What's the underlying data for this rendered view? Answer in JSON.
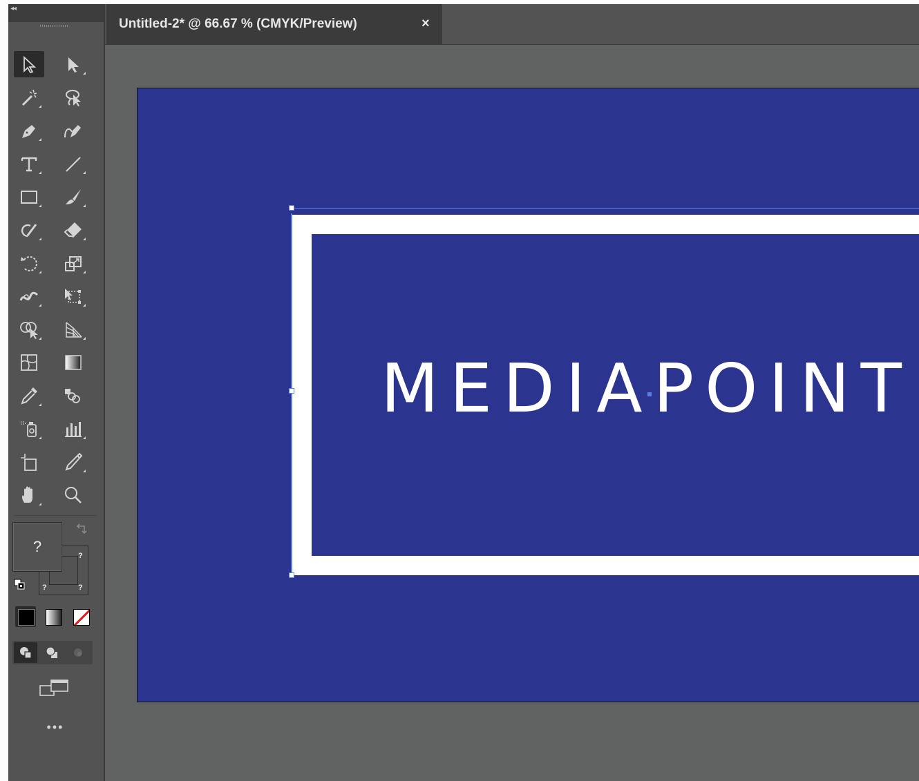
{
  "toolbar": {
    "collapse_label": "◂◂",
    "tools": [
      {
        "id": "selection-tool",
        "icon": "selection-arrow"
      },
      {
        "id": "direct-selection-tool",
        "icon": "direct-selection-arrow"
      },
      {
        "id": "magic-wand-tool",
        "icon": "magic-wand"
      },
      {
        "id": "lasso-tool",
        "icon": "lasso"
      },
      {
        "id": "pen-tool",
        "icon": "pen"
      },
      {
        "id": "curvature-tool",
        "icon": "curvature-pen"
      },
      {
        "id": "type-tool",
        "icon": "type-t"
      },
      {
        "id": "line-segment-tool",
        "icon": "line"
      },
      {
        "id": "rectangle-tool",
        "icon": "rectangle"
      },
      {
        "id": "paintbrush-tool",
        "icon": "brush"
      },
      {
        "id": "shaper-tool",
        "icon": "shaper"
      },
      {
        "id": "eraser-tool",
        "icon": "eraser"
      },
      {
        "id": "rotate-tool",
        "icon": "rotate"
      },
      {
        "id": "scale-tool",
        "icon": "scale"
      },
      {
        "id": "width-tool",
        "icon": "width"
      },
      {
        "id": "free-transform-tool",
        "icon": "free-transform"
      },
      {
        "id": "shape-builder-tool",
        "icon": "shape-builder"
      },
      {
        "id": "perspective-grid-tool",
        "icon": "perspective-grid"
      },
      {
        "id": "mesh-tool",
        "icon": "mesh"
      },
      {
        "id": "gradient-tool",
        "icon": "gradient"
      },
      {
        "id": "eyedropper-tool",
        "icon": "eyedropper"
      },
      {
        "id": "blend-tool",
        "icon": "blend"
      },
      {
        "id": "symbol-sprayer-tool",
        "icon": "symbol-sprayer"
      },
      {
        "id": "column-graph-tool",
        "icon": "column-graph"
      },
      {
        "id": "artboard-tool",
        "icon": "artboard"
      },
      {
        "id": "slice-tool",
        "icon": "slice-knife"
      },
      {
        "id": "hand-tool",
        "icon": "hand"
      },
      {
        "id": "zoom-tool",
        "icon": "magnifier"
      }
    ],
    "fill_value": "?",
    "stroke_values": [
      "?",
      "?",
      "?"
    ],
    "more_label": "•••"
  },
  "document": {
    "tab_title": "Untitled-2* @ 66.67 % (CMYK/Preview)",
    "tab_close": "×"
  },
  "artwork": {
    "logo_text": "MEDIAPOINT",
    "artboard_color": "#2b358f",
    "frame_color": "#ffffff",
    "selection_color": "#5b7ee5"
  }
}
